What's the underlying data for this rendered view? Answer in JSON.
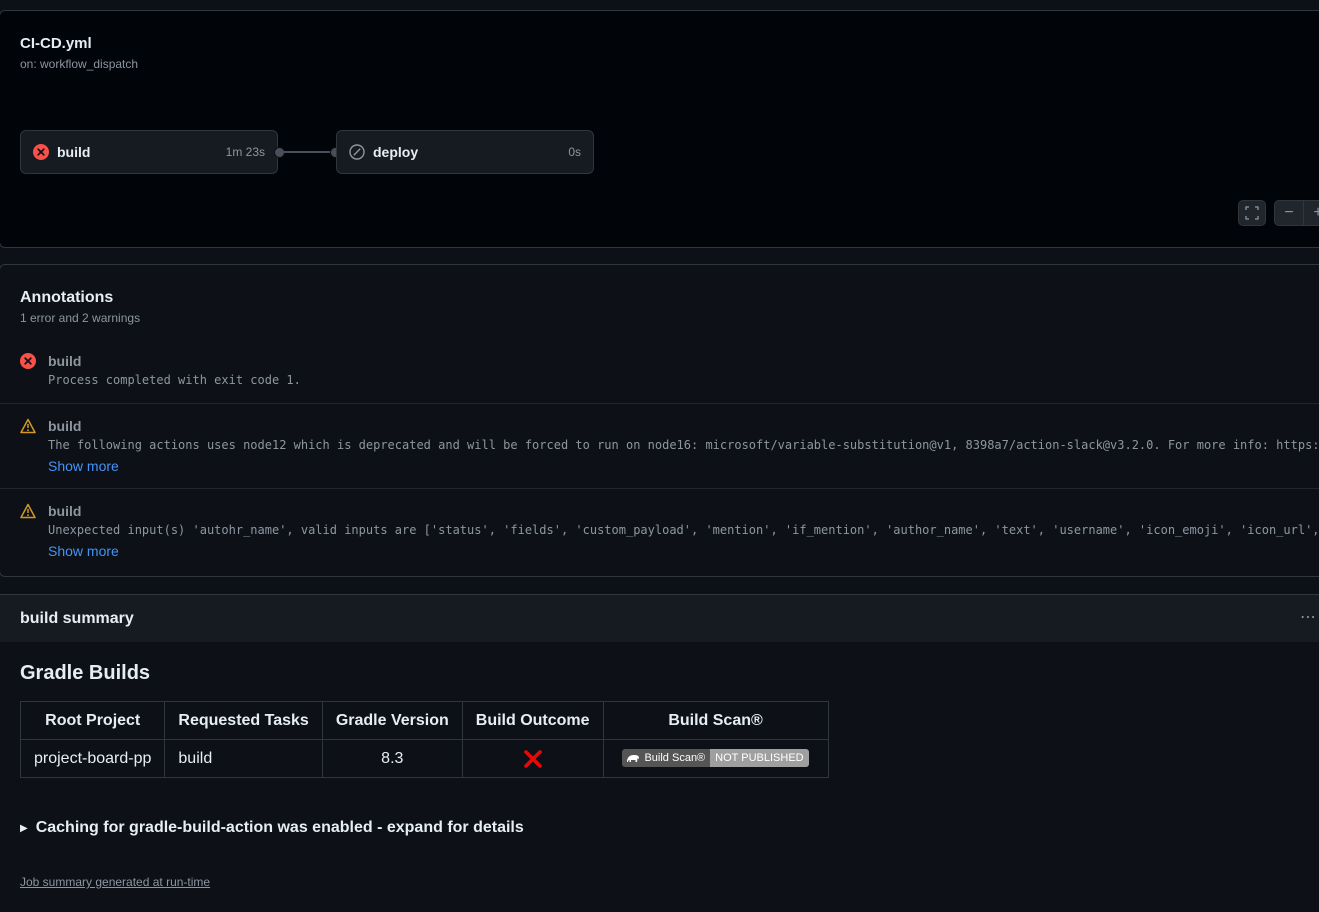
{
  "workflow": {
    "file": "CI-CD.yml",
    "trigger": "on: workflow_dispatch",
    "jobs": [
      {
        "name": "build",
        "duration": "1m 23s",
        "status": "failed"
      },
      {
        "name": "deploy",
        "duration": "0s",
        "status": "skipped"
      }
    ]
  },
  "annotations": {
    "title": "Annotations",
    "summary": "1 error and 2 warnings",
    "items": [
      {
        "level": "error",
        "job": "build",
        "message": "Process completed with exit code 1."
      },
      {
        "level": "warning",
        "job": "build",
        "message": "The following actions uses node12 which is deprecated and will be forced to run on node16: microsoft/variable-substitution@v1, 8398a7/action-slack@v3.2.0. For more info: https:",
        "more": "Show more"
      },
      {
        "level": "warning",
        "job": "build",
        "message": "Unexpected input(s) 'autohr_name', valid inputs are ['status', 'fields', 'custom_payload', 'mention', 'if_mention', 'author_name', 'text', 'username', 'icon_emoji', 'icon_url',",
        "more": "Show more"
      }
    ]
  },
  "summary": {
    "title": "build summary",
    "heading": "Gradle Builds",
    "table": {
      "headers": [
        "Root Project",
        "Requested Tasks",
        "Gradle Version",
        "Build Outcome",
        "Build Scan®"
      ],
      "row": {
        "project": "project-board-pp",
        "tasks": "build",
        "version": "8.3",
        "outcome": "failed"
      },
      "badge_left": "Build Scan®",
      "badge_right": "NOT PUBLISHED"
    },
    "details": "Caching for gradle-build-action was enabled - expand for details",
    "footer": "Job summary generated at run-time"
  },
  "colors": {
    "error": "#f85149",
    "warning": "#d29922",
    "link": "#4493f8",
    "fail_x": "#e5090a"
  }
}
